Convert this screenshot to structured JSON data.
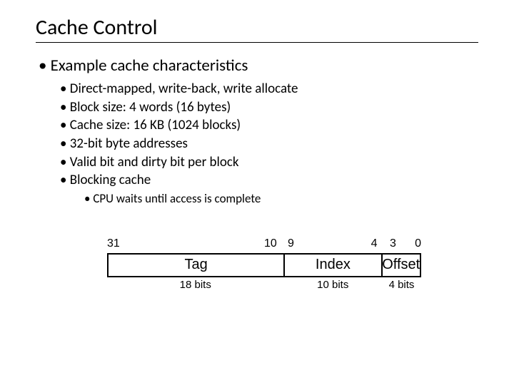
{
  "title": "Cache Control",
  "bullet1": "Example cache characteristics",
  "sub": [
    "Direct-mapped, write-back, write allocate",
    "Block size: 4 words (16 bytes)",
    "Cache size: 16 KB (1024 blocks)",
    "32-bit byte addresses",
    "Valid bit and dirty bit per block",
    "Blocking cache"
  ],
  "subsub": "CPU waits until access is complete",
  "diagram": {
    "bits": {
      "hi1": "31",
      "lo1": "10",
      "hi2": "9",
      "lo2": "4",
      "hi3": "3",
      "lo3": "0"
    },
    "fields": {
      "tag": "Tag",
      "index": "Index",
      "offset": "Offset"
    },
    "sizes": {
      "tag": "18 bits",
      "index": "10 bits",
      "offset": "4 bits"
    }
  },
  "chart_data": {
    "type": "table",
    "title": "32-bit address breakdown",
    "fields": [
      {
        "name": "Tag",
        "bit_hi": 31,
        "bit_lo": 10,
        "width_bits": 18
      },
      {
        "name": "Index",
        "bit_hi": 9,
        "bit_lo": 4,
        "width_bits": 10
      },
      {
        "name": "Offset",
        "bit_hi": 3,
        "bit_lo": 0,
        "width_bits": 4
      }
    ],
    "total_bits": 32
  }
}
